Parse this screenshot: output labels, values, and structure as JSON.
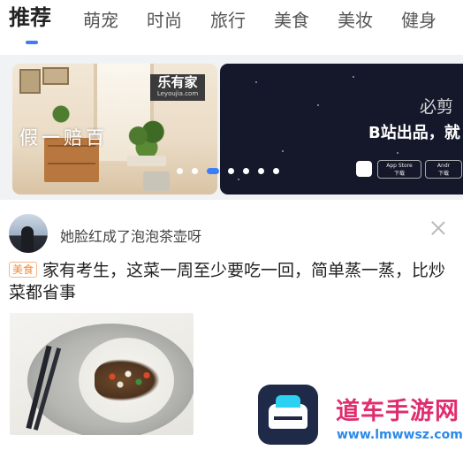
{
  "tabs": [
    {
      "label": "推荐",
      "active": true
    },
    {
      "label": "萌宠"
    },
    {
      "label": "时尚"
    },
    {
      "label": "旅行"
    },
    {
      "label": "美食"
    },
    {
      "label": "美妆"
    },
    {
      "label": "健身"
    }
  ],
  "accent_color": "#3d7df7",
  "carousel": {
    "slide_a": {
      "text": "假一赔百",
      "brand_name": "乐有家",
      "brand_url": "Leyoujia.com"
    },
    "slide_b": {
      "slogan_top": "必剪",
      "slogan_main": "B站出品，就",
      "store_button_1": "App Store",
      "store_button_1_sub": "下载",
      "store_button_2": "Andr",
      "store_button_2_sub": "下载"
    },
    "dot_count": 7,
    "active_dot": 3
  },
  "feed_card": {
    "author": "她脸红成了泡泡茶壶呀",
    "tag": "美食",
    "title": "家有考生，这菜一周至少要吃一回，简单蒸一蒸，比炒菜都省事",
    "close_icon": "close-icon"
  },
  "watermark": {
    "text": "道车手游网",
    "url": "www.lmwwsz.com"
  }
}
